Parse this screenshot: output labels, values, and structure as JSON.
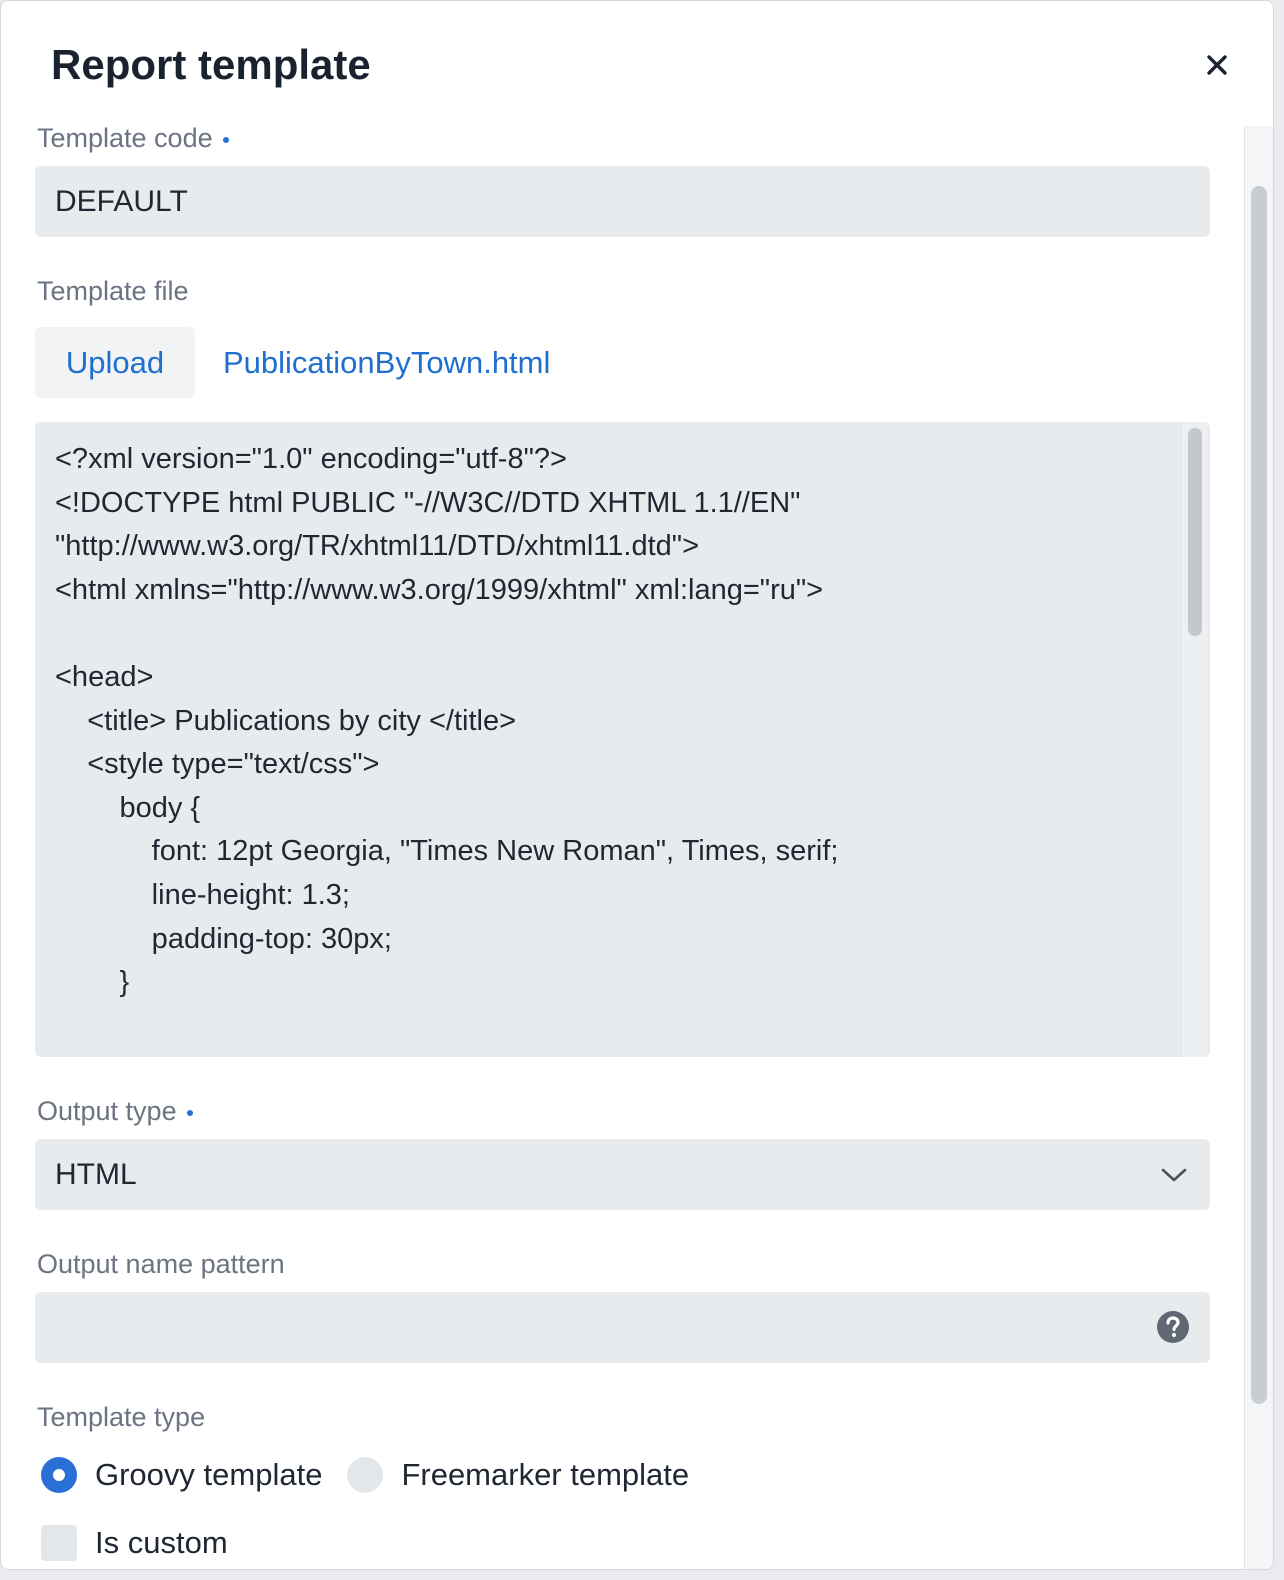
{
  "dialog": {
    "title": "Report template",
    "close_icon": "close-icon"
  },
  "template_code": {
    "label": "Template code",
    "required": true,
    "value": "DEFAULT"
  },
  "template_file": {
    "label": "Template file",
    "upload_label": "Upload",
    "file_name": "PublicationByTown.html"
  },
  "code_editor": {
    "lines": [
      "<?xml version=\"1.0\" encoding=\"utf-8\"?>",
      "<!DOCTYPE html PUBLIC \"-//W3C//DTD XHTML 1.1//EN\"",
      "\"http://www.w3.org/TR/xhtml11/DTD/xhtml11.dtd\">",
      "<html xmlns=\"http://www.w3.org/1999/xhtml\" xml:lang=\"ru\">",
      "",
      "<head>",
      "    <title> Publications by city </title>",
      "    <style type=\"text/css\">",
      "        body {",
      "            font: 12pt Georgia, \"Times New Roman\", Times, serif;",
      "            line-height: 1.3;",
      "            padding-top: 30px;",
      "        }"
    ]
  },
  "output_type": {
    "label": "Output type",
    "required": true,
    "value": "HTML",
    "icon": "chevron-down-icon"
  },
  "output_name_pattern": {
    "label": "Output name pattern",
    "value": "",
    "icon": "help-icon"
  },
  "template_type": {
    "label": "Template type",
    "options": [
      {
        "label": "Groovy template",
        "selected": true
      },
      {
        "label": "Freemarker template",
        "selected": false
      }
    ]
  },
  "is_custom": {
    "label": "Is custom",
    "checked": false
  },
  "colors": {
    "accent": "#2a6fd6",
    "link": "#1f6fd1",
    "field_bg": "#e8ebee",
    "label": "#6b7480"
  }
}
